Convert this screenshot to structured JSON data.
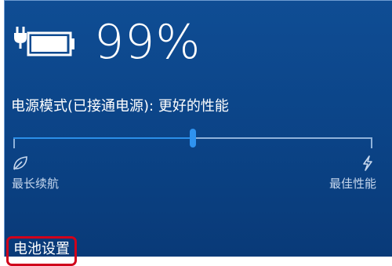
{
  "battery": {
    "percent_text": "99%",
    "icon": "battery-charging-icon",
    "level": 0.99
  },
  "power_mode": {
    "label": "电源模式(已接通电源): 更好的性能",
    "slider_value": 0.5,
    "left_label": "最长续航",
    "left_icon": "leaf-icon",
    "right_label": "最佳性能",
    "right_icon": "lightning-icon"
  },
  "settings_link": {
    "label": "电池设置"
  },
  "colors": {
    "background": "#0b4386",
    "accent": "#2f93f0",
    "highlight_box": "#d0021b"
  }
}
